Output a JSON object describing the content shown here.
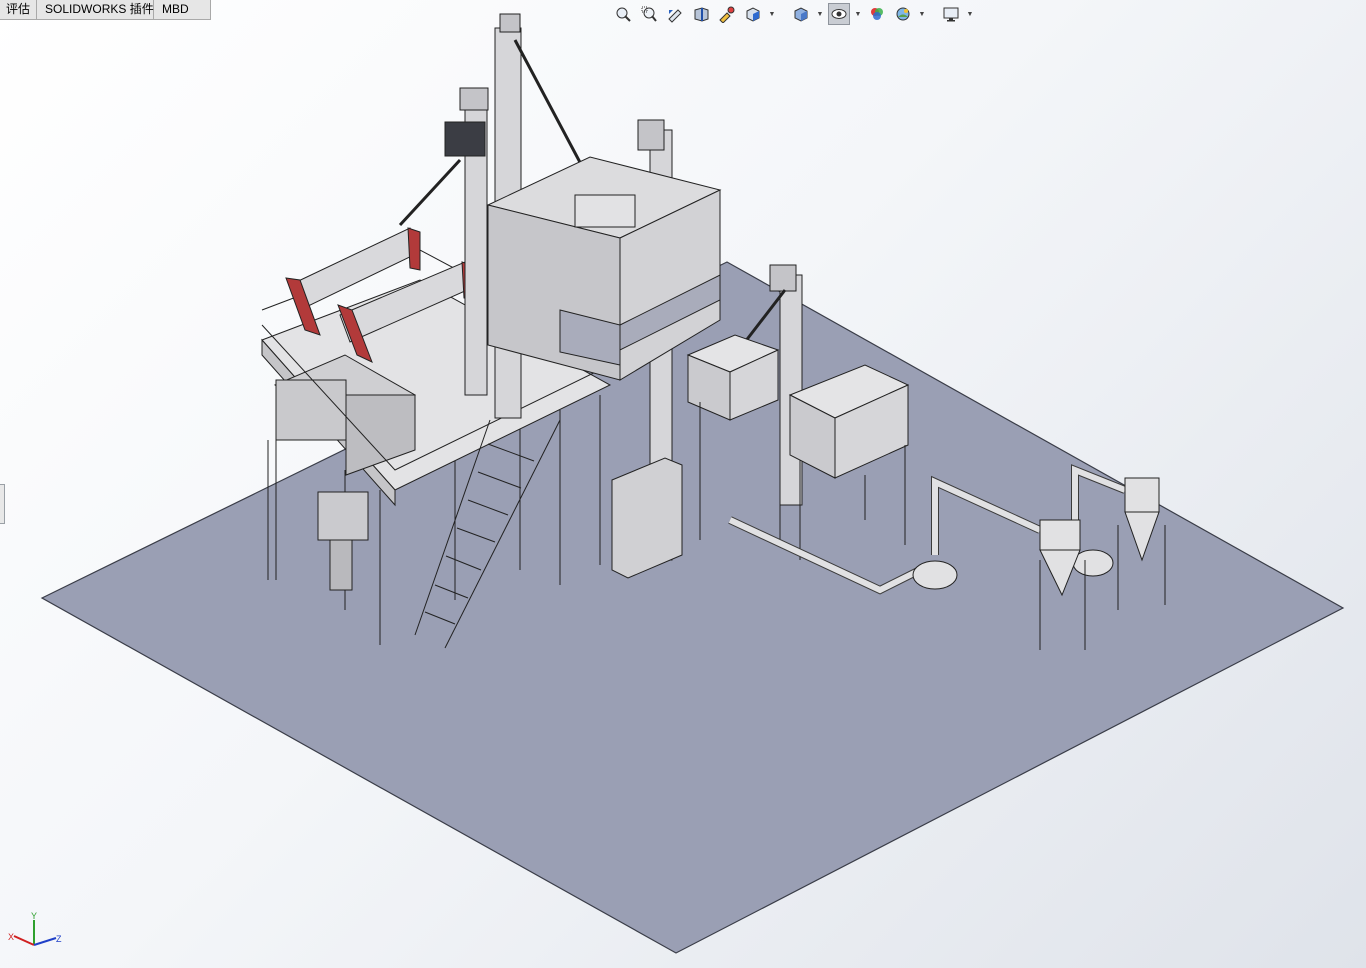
{
  "command_tabs": [
    {
      "label": "评估"
    },
    {
      "label": "SOLIDWORKS 插件"
    },
    {
      "label": "MBD"
    }
  ],
  "view_toolbar": {
    "buttons": [
      {
        "icon": "zoom-to-fit-icon"
      },
      {
        "icon": "zoom-to-area-icon"
      },
      {
        "icon": "previous-view-icon"
      },
      {
        "icon": "section-view-icon"
      },
      {
        "icon": "dynamic-annotation-icon"
      },
      {
        "icon": "view-orientation-icon"
      },
      {
        "icon": "display-style-icon"
      },
      {
        "icon": "hide-show-items-icon"
      },
      {
        "icon": "edit-appearance-icon"
      },
      {
        "icon": "apply-scene-icon"
      },
      {
        "icon": "view-settings-icon"
      }
    ]
  },
  "triad": {
    "x_label": "X",
    "y_label": "Y",
    "z_label": "Z"
  },
  "colors": {
    "floor": "#9a9fb4",
    "equipment": "#d3d3d5",
    "accent_red": "#b23a3a",
    "edges": "#222222"
  }
}
